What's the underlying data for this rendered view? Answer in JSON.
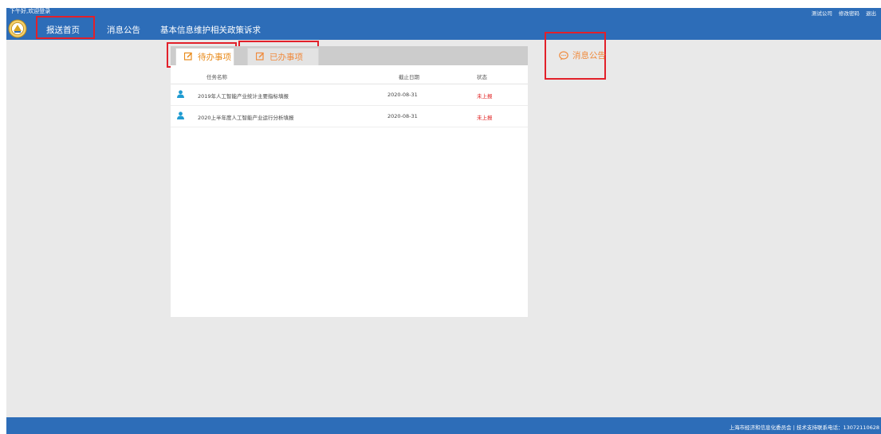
{
  "header": {
    "greeting": "下午好,欢迎登录",
    "user_links": [
      "测试公司",
      "修改密码",
      "退出"
    ]
  },
  "nav": {
    "items": [
      "报送首页",
      "消息公告",
      "基本信息维护",
      "相关政策诉求"
    ]
  },
  "tasks": {
    "tabs": [
      "待办事项",
      "已办事项"
    ],
    "columns": [
      "任务名称",
      "截止日期",
      "状态"
    ],
    "rows": [
      {
        "name": "2019年人工智能产业统计主要指标填报",
        "deadline": "2020-08-31",
        "status": "未上报"
      },
      {
        "name": "2020上半年度人工智能产业运行分析填报",
        "deadline": "2020-08-31",
        "status": "未上报"
      }
    ]
  },
  "notice": {
    "title": "消息公告"
  },
  "footer": {
    "text": "上海市经济和信息化委员会 | 技术支持联系电话：13072110628"
  },
  "colors": {
    "header_blue": "#2d6db8",
    "tab_orange": "#f08a3c",
    "status_red": "#e02020",
    "highlight_red": "#e2202a",
    "background": "#e9e9e9"
  },
  "icons": {
    "logo": "emblem-logo",
    "tab": "edit-icon",
    "row": "person-icon",
    "notice": "speech-bubble-icon"
  }
}
